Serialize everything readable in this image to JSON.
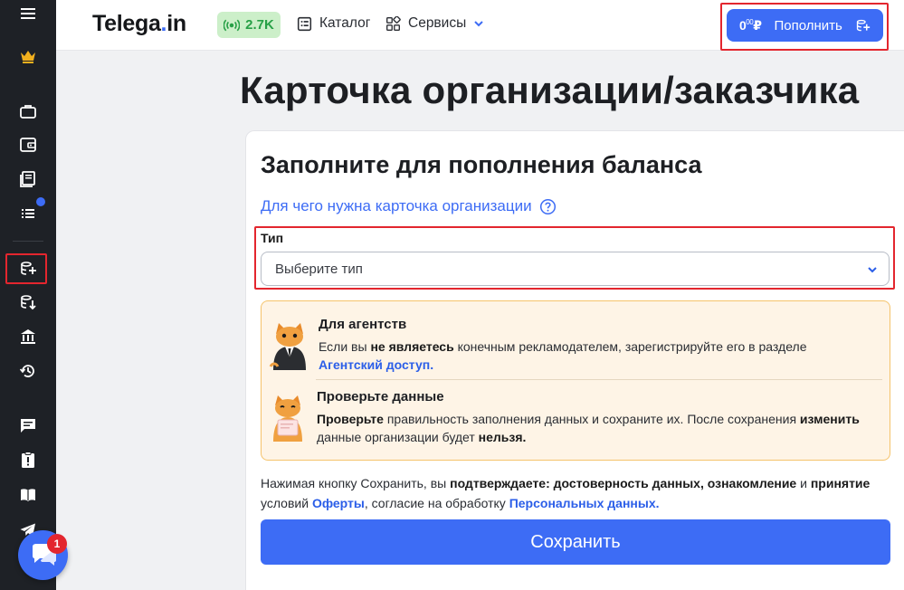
{
  "sidebar": {
    "icons": [
      "menu-icon",
      "crown-icon",
      "briefcase-icon",
      "wallet-icon",
      "book-icon",
      "list-icon",
      "coins-add-icon",
      "coins-withdraw-icon",
      "bank-icon",
      "history-icon",
      "chat-icon",
      "clipboard-alert-icon",
      "open-book-icon",
      "telegram-icon"
    ],
    "notification_dot_color": "#3d6cf5"
  },
  "header": {
    "logo_main": "Telega",
    "logo_dot": ".",
    "logo_tld": "in",
    "online_count": "2.7K",
    "catalog_label": "Каталог",
    "services_label": "Сервисы",
    "balance_int": "0",
    "balance_dec": "00",
    "currency": "₽",
    "topup_label": "Пополнить"
  },
  "page": {
    "title": "Карточка организации/заказчика"
  },
  "card": {
    "title": "Заполните для пополнения баланса",
    "help_link": "Для чего нужна карточка организации",
    "type_label": "Тип",
    "type_placeholder": "Выберите тип",
    "agency": {
      "heading": "Для агентств",
      "p1": "Если вы ",
      "b1": "не являетесь",
      "p2": " конечным рекламодателем, зарегистрируйте его в разделе ",
      "link": "Агентский доступ."
    },
    "check": {
      "heading": "Проверьте данные",
      "b1": "Проверьте",
      "p1": " правильность заполнения данных и сохраните их. После сохранения ",
      "b2": "изменить",
      "p2": " данные организации будет ",
      "b3": "нельзя."
    },
    "consent": {
      "p1": "Нажимая кнопку Сохранить, вы ",
      "b1": "подтверждаете:",
      "p2": " ",
      "b2": "достоверность данных, ознакомление",
      "p3": " и ",
      "b3": "принятие",
      "p4": " условий ",
      "link1": "Оферты",
      "p5": ", согласие на обработку ",
      "link2": "Персональных данных."
    },
    "save_label": "Сохранить"
  },
  "chat_widget": {
    "badge_count": "1"
  },
  "colors": {
    "accent": "#3d6cf5",
    "highlight": "#e3262e",
    "online_green": "#27a046",
    "info_bg": "#fef4e6",
    "info_border": "#f5c36b"
  }
}
